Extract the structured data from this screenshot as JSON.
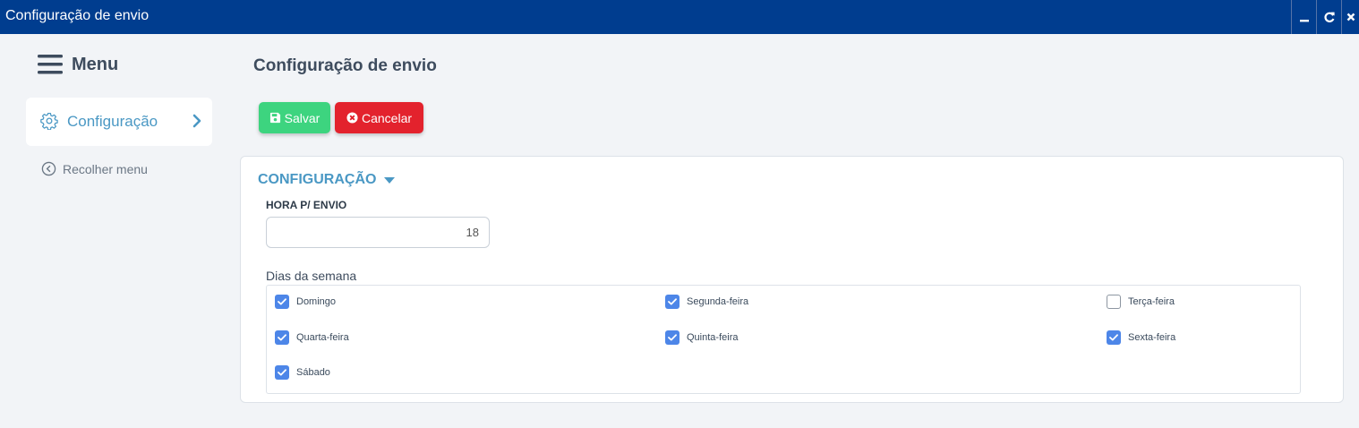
{
  "window": {
    "title": "Configuração de envio",
    "controls": [
      "minimize-icon",
      "refresh-icon",
      "close-icon"
    ]
  },
  "sidebar": {
    "menu_label": "Menu",
    "items": [
      {
        "label": "Configuração",
        "icon": "gear-icon",
        "active": true
      }
    ],
    "collapse_label": "Recolher menu"
  },
  "main": {
    "page_title": "Configuração de envio",
    "toolbar": {
      "save_label": "Salvar",
      "cancel_label": "Cancelar"
    },
    "section": {
      "title": "CONFIGURAÇÃO",
      "hour_label": "HORA P/ ENVIO",
      "hour_value": "18",
      "days_label": "Dias da semana",
      "days": [
        {
          "label": "Domingo",
          "checked": true
        },
        {
          "label": "Segunda-feira",
          "checked": true
        },
        {
          "label": "Terça-feira",
          "checked": false
        },
        {
          "label": "Quarta-feira",
          "checked": true
        },
        {
          "label": "Quinta-feira",
          "checked": true
        },
        {
          "label": "Sexta-feira",
          "checked": true
        },
        {
          "label": "Sábado",
          "checked": true
        }
      ]
    }
  },
  "colors": {
    "titlebar": "#003d8f",
    "accent": "#4a98c4",
    "save": "#3dd47f",
    "cancel": "#e3222d",
    "checkbox": "#4d86e8"
  }
}
